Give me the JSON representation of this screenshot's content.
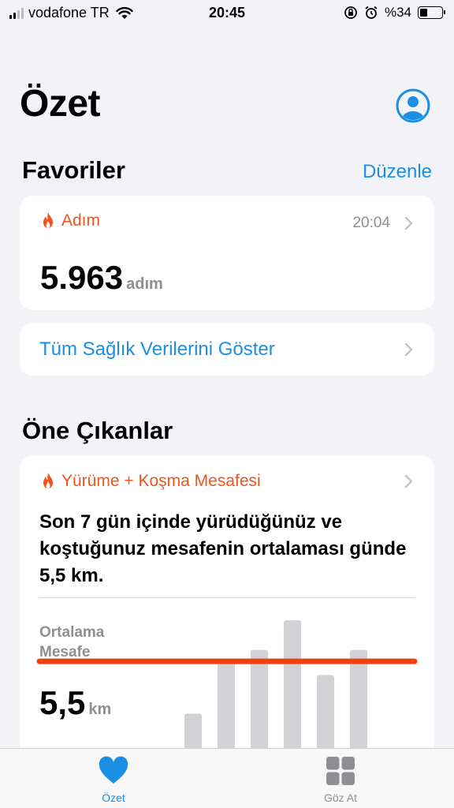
{
  "status_bar": {
    "carrier": "vodafone TR",
    "time": "20:45",
    "battery": "%34",
    "battery_level": 0.34
  },
  "header": {
    "title": "Özet"
  },
  "favorites": {
    "title": "Favoriler",
    "edit_label": "Düzenle",
    "metric": {
      "name": "Adım",
      "time": "20:04",
      "value": "5.963",
      "unit": "adım"
    },
    "show_all_label": "Tüm Sağlık Verilerini Göster"
  },
  "highlights": {
    "title": "Öne Çıkanlar",
    "card": {
      "metric": "Yürüme + Koşma Mesafesi",
      "description": "Son 7 gün içinde yürüdüğünüz ve koştuğunuz mesafenin ortalaması günde 5,5 km.",
      "avg_label": "Ortalama Mesafe",
      "avg_value": "5,5",
      "avg_unit": "km"
    }
  },
  "chart_data": {
    "type": "bar",
    "values": [
      3.2,
      5.6,
      6.0,
      7.3,
      4.9,
      6.0
    ],
    "average": 5.5,
    "ylim": [
      0,
      9
    ],
    "colors": {
      "bar": "#d1d1d6",
      "average_line": "#f0400e"
    }
  },
  "tab_bar": {
    "items": [
      {
        "label": "Özet",
        "icon": "heart-icon",
        "active": true
      },
      {
        "label": "Göz At",
        "icon": "grid-icon",
        "active": false
      }
    ]
  },
  "colors": {
    "accent": "#1a8fe3",
    "metric_orange": "#f0531c",
    "background": "#f2f2f7"
  }
}
